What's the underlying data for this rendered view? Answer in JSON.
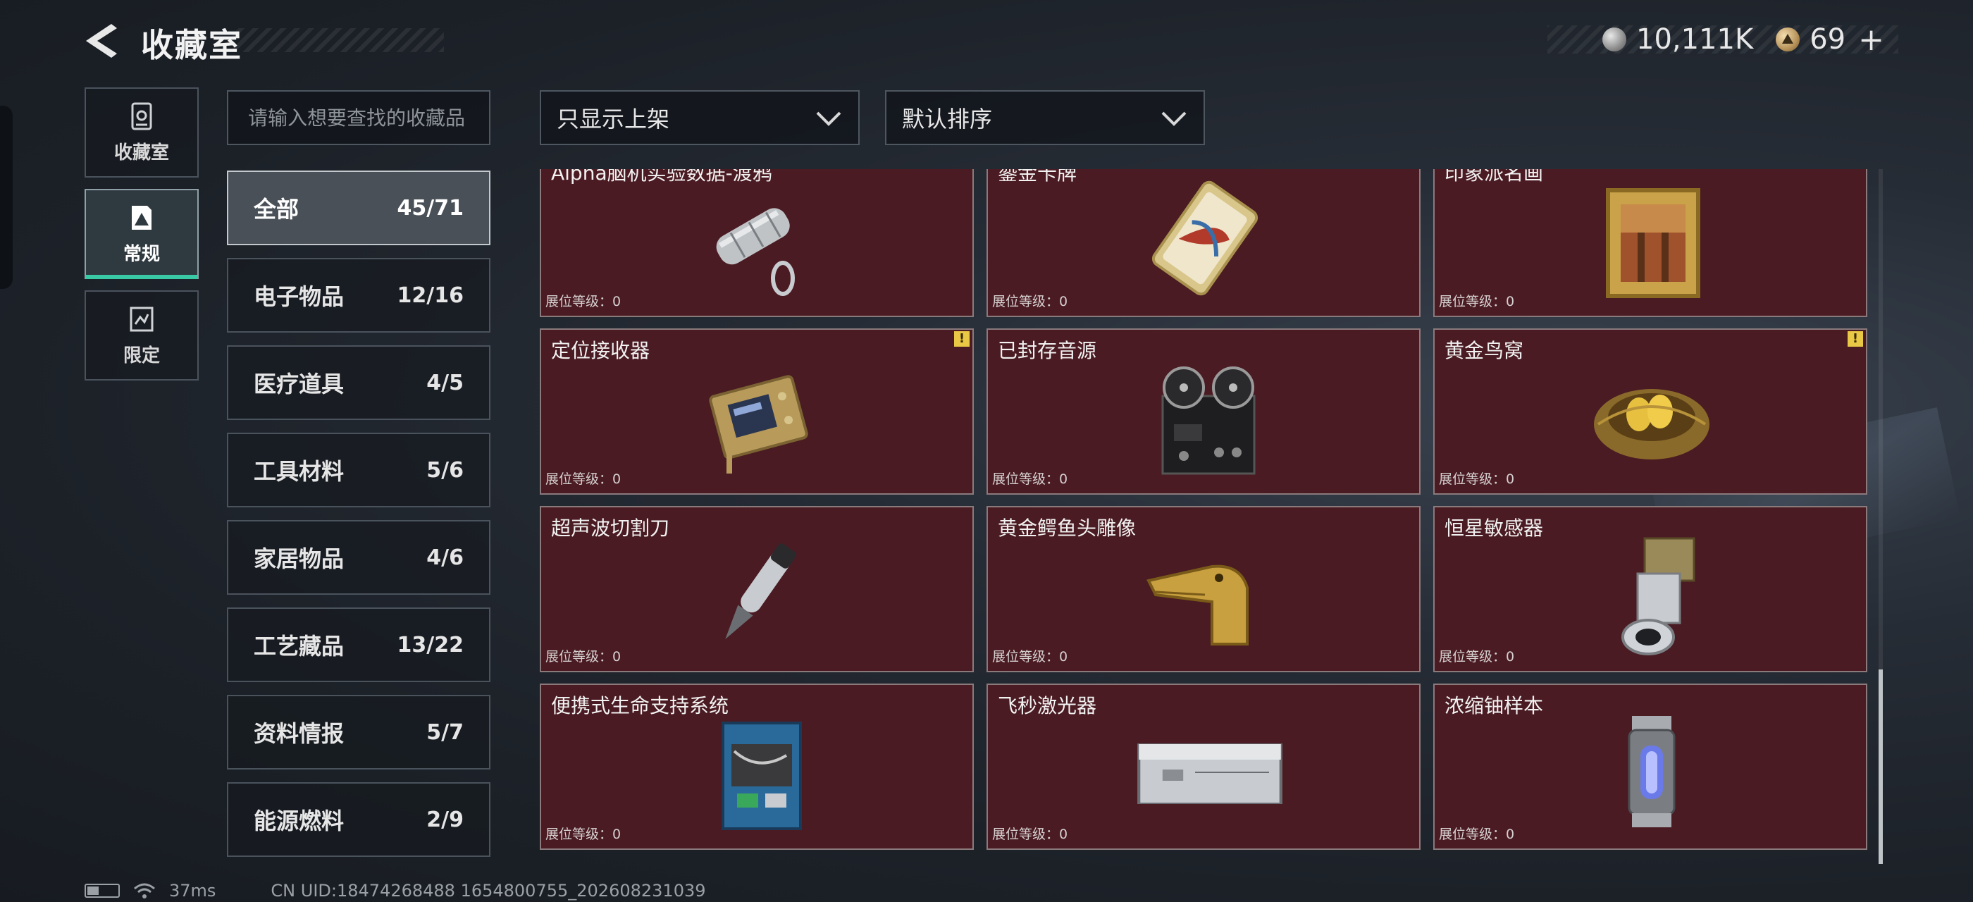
{
  "header": {
    "title": "收藏室",
    "currency": [
      {
        "icon": "silver-coin-icon",
        "value": "10,111K"
      },
      {
        "icon": "gold-triangle-coin-icon",
        "value": "69",
        "action": "+"
      }
    ]
  },
  "mode_nav": [
    {
      "label": "收藏室",
      "icon": "collection-room-icon",
      "active": false
    },
    {
      "label": "常规",
      "icon": "regular-icon",
      "active": true
    },
    {
      "label": "限定",
      "icon": "limited-icon",
      "active": false
    }
  ],
  "search": {
    "placeholder": "请输入想要查找的收藏品",
    "value": ""
  },
  "filters": {
    "display": "只显示上架",
    "sort": "默认排序"
  },
  "categories": [
    {
      "name": "全部",
      "count": "45/71",
      "active": true
    },
    {
      "name": "电子物品",
      "count": "12/16"
    },
    {
      "name": "医疗道具",
      "count": "4/5"
    },
    {
      "name": "工具材料",
      "count": "5/6"
    },
    {
      "name": "家居物品",
      "count": "4/6"
    },
    {
      "name": "工艺藏品",
      "count": "13/22"
    },
    {
      "name": "资料情报",
      "count": "5/7"
    },
    {
      "name": "能源燃料",
      "count": "2/9"
    }
  ],
  "items": [
    {
      "name": "Alpha脑机实验数据-渡鸦",
      "level": "展位等级：0",
      "flag": false,
      "art": "silver-canister-keychain"
    },
    {
      "name": "鎏金卡牌",
      "level": "展位等级：0",
      "flag": true,
      "art": "gilded-card"
    },
    {
      "name": "印象派名画",
      "level": "展位等级：0",
      "flag": false,
      "art": "framed-painting"
    },
    {
      "name": "定位接收器",
      "level": "展位等级：0",
      "flag": true,
      "art": "gold-receiver-box"
    },
    {
      "name": "已封存音源",
      "level": "展位等级：0",
      "flag": false,
      "art": "reel-to-reel-recorder"
    },
    {
      "name": "黄金鸟窝",
      "level": "展位等级：0",
      "flag": true,
      "art": "golden-bird-nest"
    },
    {
      "name": "超声波切割刀",
      "level": "展位等级：0",
      "flag": false,
      "art": "ultrasonic-knife"
    },
    {
      "name": "黄金鳄鱼头雕像",
      "level": "展位等级：0",
      "flag": false,
      "art": "golden-crocodile-statue"
    },
    {
      "name": "恒星敏感器",
      "level": "展位等级：0",
      "flag": false,
      "art": "star-sensor"
    },
    {
      "name": "便携式生命支持系统",
      "level": "展位等级：0",
      "flag": false,
      "art": "life-support-unit"
    },
    {
      "name": "飞秒激光器",
      "level": "展位等级：0",
      "flag": false,
      "art": "femtosecond-laser"
    },
    {
      "name": "浓缩铀样本",
      "level": "展位等级：0",
      "flag": false,
      "art": "uranium-capsule"
    }
  ],
  "warning_mark": "!",
  "status_bar": {
    "ping": "37ms",
    "uid": "CN UID:18474268488 1654800755_202608231039"
  },
  "colors": {
    "card_bg": "#4a1b22",
    "accent": "#39c9a5",
    "warning": "#e9c845"
  }
}
